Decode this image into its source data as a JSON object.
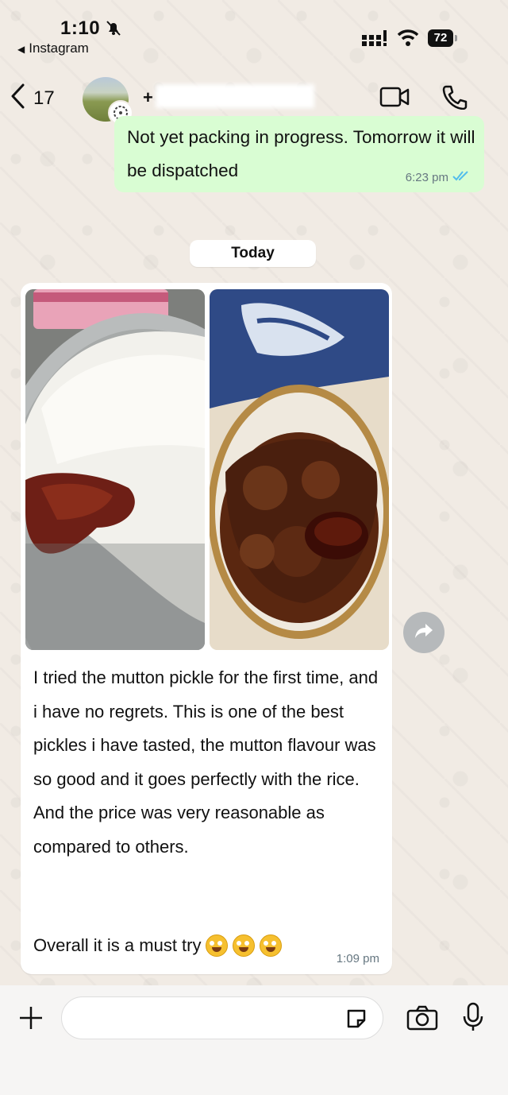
{
  "status_bar": {
    "time": "1:10",
    "back_app": "Instagram",
    "battery": "72"
  },
  "header": {
    "back_count": "17",
    "contact_name": "+"
  },
  "messages": {
    "outgoing": {
      "text": "Not yet packing in progress. Tomorrow it will be dispatched",
      "time": "6:23 pm"
    },
    "date_separator": "Today",
    "incoming": {
      "text": "I tried the mutton pickle for the first time, and i have no regrets. This is one of the best pickles i have tasted, the mutton flavour was so good and it goes perfectly with the rice. And the price was very reasonable as compared to others.",
      "last_line": "Overall it is a must try",
      "emojis": [
        "star-struck-emoji",
        "star-struck-emoji",
        "star-struck-emoji"
      ],
      "time": "1:09 pm"
    }
  },
  "composer": {
    "placeholder": ""
  },
  "icons": {
    "bell": "bell-slash-icon",
    "signal": "signal-icon",
    "wifi": "wifi-icon",
    "back": "chevron-left-icon",
    "video": "video-call-icon",
    "phone": "phone-icon",
    "read_receipt": "double-check-icon",
    "forward": "forward-icon",
    "plus": "plus-icon",
    "sticker": "sticker-icon",
    "camera": "camera-icon",
    "mic": "mic-icon"
  },
  "colors": {
    "outgoing_bubble": "#d9fdd3",
    "read_tick": "#53bdeb",
    "wallpaper": "#f1ebe4"
  }
}
